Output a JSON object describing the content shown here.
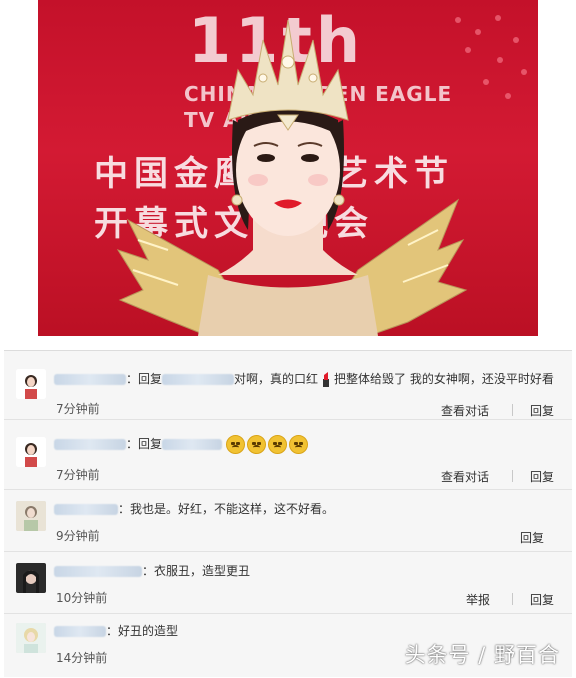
{
  "banner": {
    "logo": "11th",
    "en_line1": "CHINA GOLDEN EAGLE",
    "en_line2": "TV ART",
    "cn_line1": "中国金鹰电视艺术节",
    "cn_line2": "开幕式文艺晚会"
  },
  "comments": [
    {
      "prefix": "：回复",
      "text": "对啊，真的口红",
      "text2": "把整体给毁了 我的女神啊，还没平时好看",
      "time": "7分钟前",
      "action1": "查看对话",
      "reply": "回复"
    },
    {
      "prefix": "：回复",
      "text": "",
      "emoji_count": "4",
      "time": "7分钟前",
      "action1": "查看对话",
      "reply": "回复"
    },
    {
      "prefix": "：",
      "text": "我也是。好红，不能这样，这不好看。",
      "time": "9分钟前",
      "reply": "回复"
    },
    {
      "prefix": "：",
      "text": "衣服丑，造型更丑",
      "time": "10分钟前",
      "action1": "举报",
      "reply": "回复"
    },
    {
      "prefix": "：",
      "text": "好丑的造型",
      "time": "14分钟前"
    }
  ],
  "watermark": "头条号 / 野百合",
  "colors": {
    "banner_red": "#c4112a",
    "lipstick_red": "#e01b2a",
    "gold": "#e2c57a"
  }
}
